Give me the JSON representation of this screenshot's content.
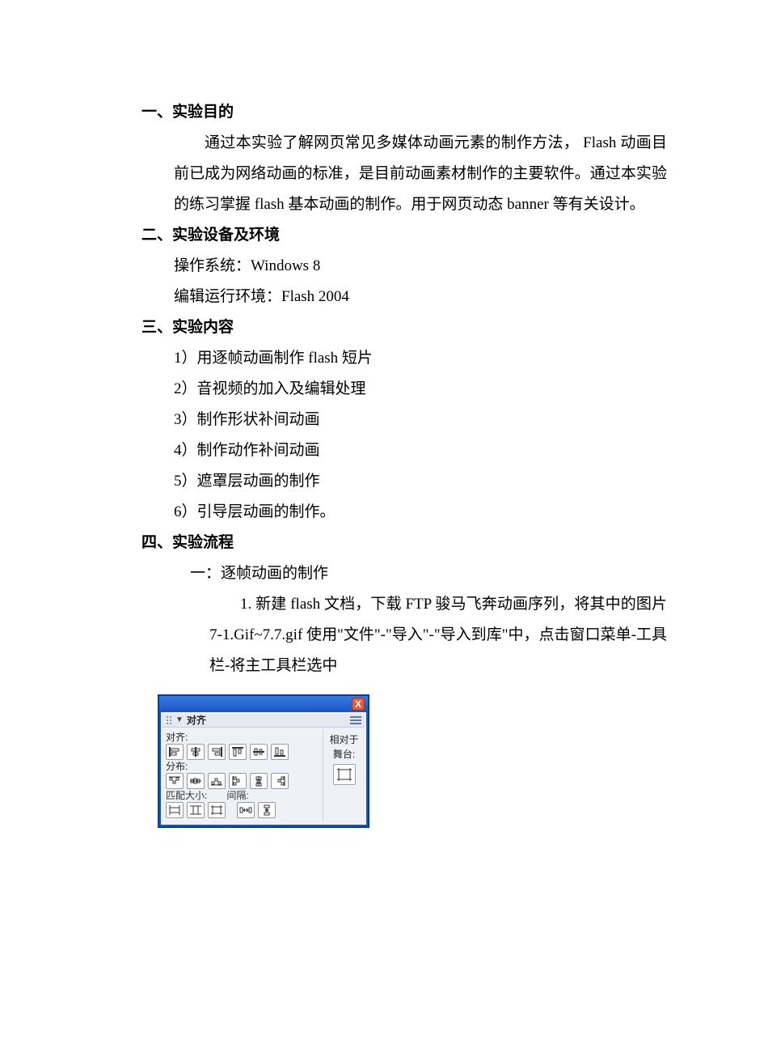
{
  "sections": {
    "s1": {
      "heading": "一、实验目的",
      "para": "通过本实验了解网页常见多媒体动画元素的制作方法， Flash 动画目前已成为网络动画的标准，是目前动画素材制作的主要软件。通过本实验的练习掌握 flash 基本动画的制作。用于网页动态 banner 等有关设计。"
    },
    "s2": {
      "heading": "二、实验设备及环境",
      "lines": {
        "os": "操作系统：Windows 8",
        "env": "编辑运行环境：Flash 2004"
      }
    },
    "s3": {
      "heading": "三、实验内容",
      "items": {
        "i1": "1）用逐帧动画制作 flash 短片",
        "i2": "2）音视频的加入及编辑处理",
        "i3": "3）制作形状补间动画",
        "i4": "4）制作动作补间动画",
        "i5": "5）遮罩层动画的制作",
        "i6": "6）引导层动画的制作。"
      }
    },
    "s4": {
      "heading": "四、实验流程",
      "part1": {
        "title": "一：逐帧动画的制作",
        "step1": "1. 新建 flash 文档，下载 FTP 骏马飞奔动画序列，将其中的图片 7-1.Gif~7.7.gif 使用\"文件\"-\"导入\"-\"导入到库\"中，点击窗口菜单-工具栏-将主工具栏选中"
      }
    }
  },
  "panel": {
    "close": "X",
    "disclosure": "▼",
    "title": "对齐",
    "section_align": "对齐:",
    "section_distribute": "分布:",
    "section_match": "匹配大小:",
    "section_space": "间隔:",
    "right_label1": "相对于",
    "right_label2": "舞台:"
  }
}
